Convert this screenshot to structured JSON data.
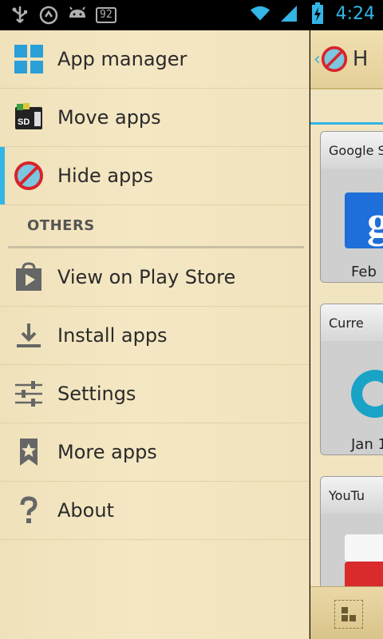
{
  "status_bar": {
    "icons": [
      "usb-icon",
      "sync-icon",
      "android-icon",
      "wifi-icon",
      "signal-icon",
      "battery-icon"
    ],
    "battery_badge": "92",
    "time": "4:24",
    "accent_color": "#33b5e5"
  },
  "drawer": {
    "items": [
      {
        "label": "App manager",
        "icon": "app-manager-icon",
        "active": false
      },
      {
        "label": "Move apps",
        "icon": "sd-card-icon",
        "active": false
      },
      {
        "label": "Hide apps",
        "icon": "hide-apps-icon",
        "active": true
      }
    ],
    "section_header": "OTHERS",
    "other_items": [
      {
        "label": "View on Play Store",
        "icon": "play-store-icon"
      },
      {
        "label": "Install apps",
        "icon": "download-icon"
      },
      {
        "label": "Settings",
        "icon": "sliders-icon"
      },
      {
        "label": "More apps",
        "icon": "bookmark-star-icon"
      },
      {
        "label": "About",
        "icon": "question-icon"
      }
    ]
  },
  "content": {
    "action_bar_title": "H",
    "cards": [
      {
        "title": "Google S",
        "date": "Feb"
      },
      {
        "title": "Curre",
        "date": "Jan 1"
      },
      {
        "title": "YouTu",
        "date": ""
      }
    ]
  }
}
